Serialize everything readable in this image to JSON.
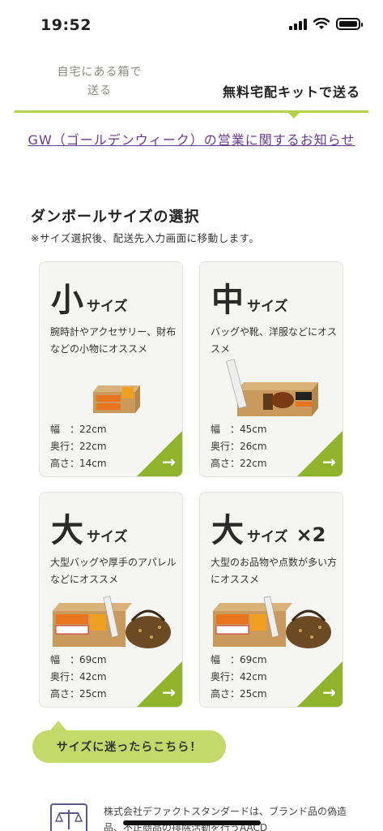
{
  "status": {
    "time": "19:52"
  },
  "tabs": {
    "left_line1": "自宅にある箱で",
    "left_line2": "送る",
    "right": "無料宅配キットで送る"
  },
  "notice": {
    "text": "GW（ゴールデンウィーク）の営業に関するお知らせ"
  },
  "section": {
    "title": "ダンボールサイズの選択",
    "note": "※サイズ選択後、配送先入力画面に移動します。"
  },
  "cards": [
    {
      "big": "小",
      "word": "サイズ",
      "mult": "",
      "desc": "腕時計やアクセサリー、財布などの小物にオススメ",
      "width_label": "幅　：",
      "width": "22cm",
      "depth_label": "奥行：",
      "depth": "22cm",
      "height_label": "高さ：",
      "height": "14cm",
      "arrow": "→"
    },
    {
      "big": "中",
      "word": "サイズ",
      "mult": "",
      "desc": "バッグや靴、洋服などにオススメ",
      "width_label": "幅　：",
      "width": "45cm",
      "depth_label": "奥行：",
      "depth": "26cm",
      "height_label": "高さ：",
      "height": "22cm",
      "arrow": "→"
    },
    {
      "big": "大",
      "word": "サイズ",
      "mult": "",
      "desc": "大型バッグや厚手のアパレルなどにオススメ",
      "width_label": "幅　：",
      "width": "69cm",
      "depth_label": "奥行：",
      "depth": "42cm",
      "height_label": "高さ：",
      "height": "25cm",
      "arrow": "→"
    },
    {
      "big": "大",
      "word": "サイズ",
      "mult": "×2",
      "desc": "大型のお品物や点数が多い方にオススメ",
      "width_label": "幅　：",
      "width": "69cm",
      "depth_label": "奥行：",
      "depth": "42cm",
      "height_label": "高さ：",
      "height": "25cm",
      "arrow": "→"
    }
  ],
  "help": {
    "label": "サイズに迷ったらこちら！"
  },
  "footer": {
    "text": "株式会社デファクトスタンダードは、ブランド品の偽造品、不正商品の排除活動を行うAACD"
  },
  "colors": {
    "accent": "#b7d04a",
    "corner": "#8fb32b",
    "link": "#6a3a8f",
    "help_bg": "#c5d96a"
  }
}
